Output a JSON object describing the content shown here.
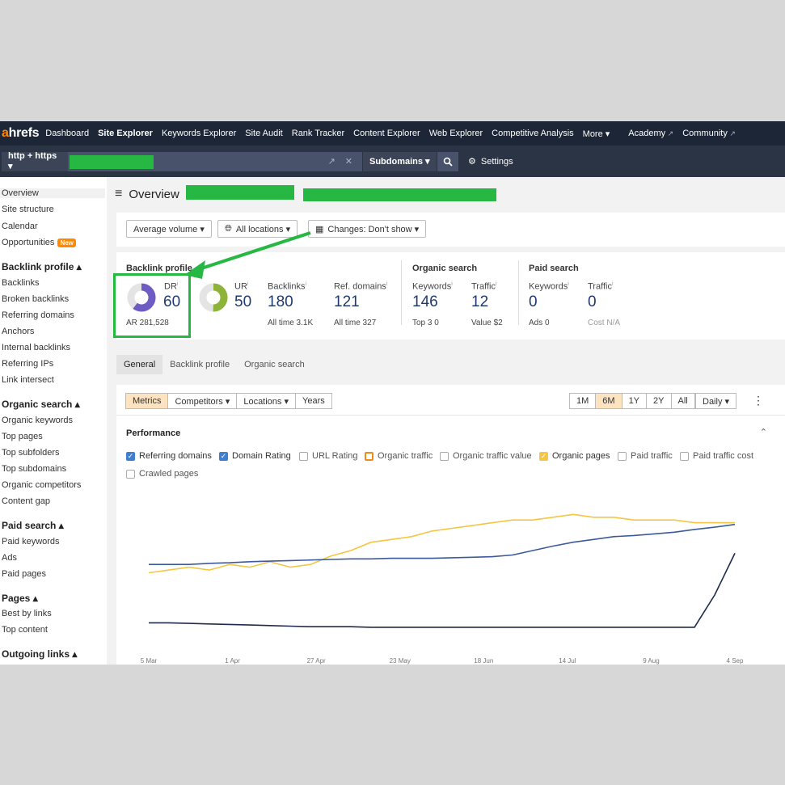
{
  "nav": {
    "logo_a": "a",
    "logo_rest": "hrefs",
    "items": [
      "Dashboard",
      "Site Explorer",
      "Keywords Explorer",
      "Site Audit",
      "Rank Tracker",
      "Content Explorer",
      "Web Explorer",
      "Competitive Analysis",
      "More ▾"
    ],
    "external": [
      "Academy",
      "Community"
    ]
  },
  "urlbar": {
    "protocol": "http + https ▾",
    "subdomains": "Subdomains ▾",
    "settings": "Settings"
  },
  "sidebar": {
    "top": [
      "Overview",
      "Site structure",
      "Calendar",
      "Opportunities"
    ],
    "new_badge": "New",
    "sections": [
      {
        "title": "Backlink profile ▴",
        "items": [
          "Backlinks",
          "Broken backlinks",
          "Referring domains",
          "Anchors",
          "Internal backlinks",
          "Referring IPs",
          "Link intersect"
        ]
      },
      {
        "title": "Organic search ▴",
        "items": [
          "Organic keywords",
          "Top pages",
          "Top subfolders",
          "Top subdomains",
          "Organic competitors",
          "Content gap"
        ]
      },
      {
        "title": "Paid search ▴",
        "items": [
          "Paid keywords",
          "Ads",
          "Paid pages"
        ]
      },
      {
        "title": "Pages ▴",
        "items": [
          "Best by links",
          "Top content"
        ]
      },
      {
        "title": "Outgoing links ▴",
        "items": []
      }
    ]
  },
  "main": {
    "title": "Overview",
    "filters": [
      "Average volume ▾",
      "All locations ▾",
      "Changes: Don't show ▾"
    ]
  },
  "metrics": {
    "backlink_header": "Backlink profile",
    "organic_header": "Organic search",
    "paid_header": "Paid search",
    "dr": {
      "label": "DR",
      "value": "60",
      "sub": "AR 281,528",
      "fill": 0.6
    },
    "ur": {
      "label": "UR",
      "value": "50",
      "fill": 0.5
    },
    "backlinks": {
      "label": "Backlinks",
      "value": "180",
      "sub": "All time 3.1K"
    },
    "ref_domains": {
      "label": "Ref. domains",
      "value": "121",
      "sub": "All time 327"
    },
    "org_keywords": {
      "label": "Keywords",
      "value": "146",
      "sub": "Top 3  0"
    },
    "org_traffic": {
      "label": "Traffic",
      "value": "12",
      "sub": "Value $2"
    },
    "paid_keywords": {
      "label": "Keywords",
      "value": "0",
      "sub": "Ads 0"
    },
    "paid_traffic": {
      "label": "Traffic",
      "value": "0",
      "sub": "Cost N/A"
    },
    "info_mark": "i"
  },
  "tabs": [
    "General",
    "Backlink profile",
    "Organic search"
  ],
  "panel": {
    "left_group": [
      "Metrics",
      "Competitors ▾",
      "Locations ▾",
      "Years"
    ],
    "ranges": [
      "1M",
      "6M",
      "1Y",
      "2Y",
      "All"
    ],
    "interval": "Daily ▾",
    "more": "⋮",
    "performance": "Performance",
    "checkboxes": [
      {
        "label": "Referring domains",
        "state": "checked-blue"
      },
      {
        "label": "Domain Rating",
        "state": "checked-blue"
      },
      {
        "label": "URL Rating",
        "state": "unchecked"
      },
      {
        "label": "Organic traffic",
        "state": "orange-outline"
      },
      {
        "label": "Organic traffic value",
        "state": "unchecked"
      },
      {
        "label": "Organic pages",
        "state": "checked-yellow"
      },
      {
        "label": "Paid traffic",
        "state": "unchecked"
      },
      {
        "label": "Paid traffic cost",
        "state": "unchecked"
      },
      {
        "label": "Crawled pages",
        "state": "unchecked"
      }
    ]
  },
  "colors": {
    "nav_bg": "#1d2636",
    "accent_orange": "#ff8800",
    "highlight_green": "#27b743",
    "dr_purple": "#6f5bc4",
    "ur_green": "#8db33a",
    "series_yellow": "#f5c543",
    "series_blue": "#3c5a9a",
    "series_navy": "#1f2a4a"
  },
  "chart_data": {
    "type": "line",
    "x_ticks": [
      "5 Mar",
      "1 Apr",
      "27 Apr",
      "23 May",
      "18 Jun",
      "14 Jul",
      "9 Aug",
      "4 Sep"
    ],
    "series": [
      {
        "name": "Organic pages",
        "color": "#f5c543",
        "values": [
          12,
          12.5,
          13,
          12.5,
          13.5,
          13,
          14,
          13,
          13.5,
          15,
          16,
          17.5,
          18,
          18.5,
          19.5,
          20,
          20.5,
          21,
          21.5,
          21.5,
          22,
          22.5,
          22,
          22,
          21.5,
          21.5,
          21.5,
          21,
          21,
          21
        ]
      },
      {
        "name": "Domain Rating",
        "color": "#3c5a9a",
        "values": [
          13.5,
          13.5,
          13.5,
          13.7,
          13.8,
          14,
          14.1,
          14.2,
          14.3,
          14.4,
          14.5,
          14.5,
          14.6,
          14.6,
          14.6,
          14.7,
          14.8,
          14.9,
          15.2,
          16,
          16.8,
          17.5,
          18,
          18.5,
          18.7,
          19,
          19.3,
          19.8,
          20.2,
          20.7
        ]
      },
      {
        "name": "Referring domains",
        "color": "#1f2a4a",
        "values": [
          3,
          3,
          2.9,
          2.8,
          2.7,
          2.6,
          2.5,
          2.4,
          2.3,
          2.3,
          2.3,
          2.2,
          2.2,
          2.2,
          2.2,
          2.2,
          2.2,
          2.2,
          2.2,
          2.2,
          2.2,
          2.2,
          2.2,
          2.2,
          2.2,
          2.2,
          2.2,
          2.2,
          8,
          15.5
        ]
      }
    ],
    "ylim": [
      0,
      24
    ]
  }
}
